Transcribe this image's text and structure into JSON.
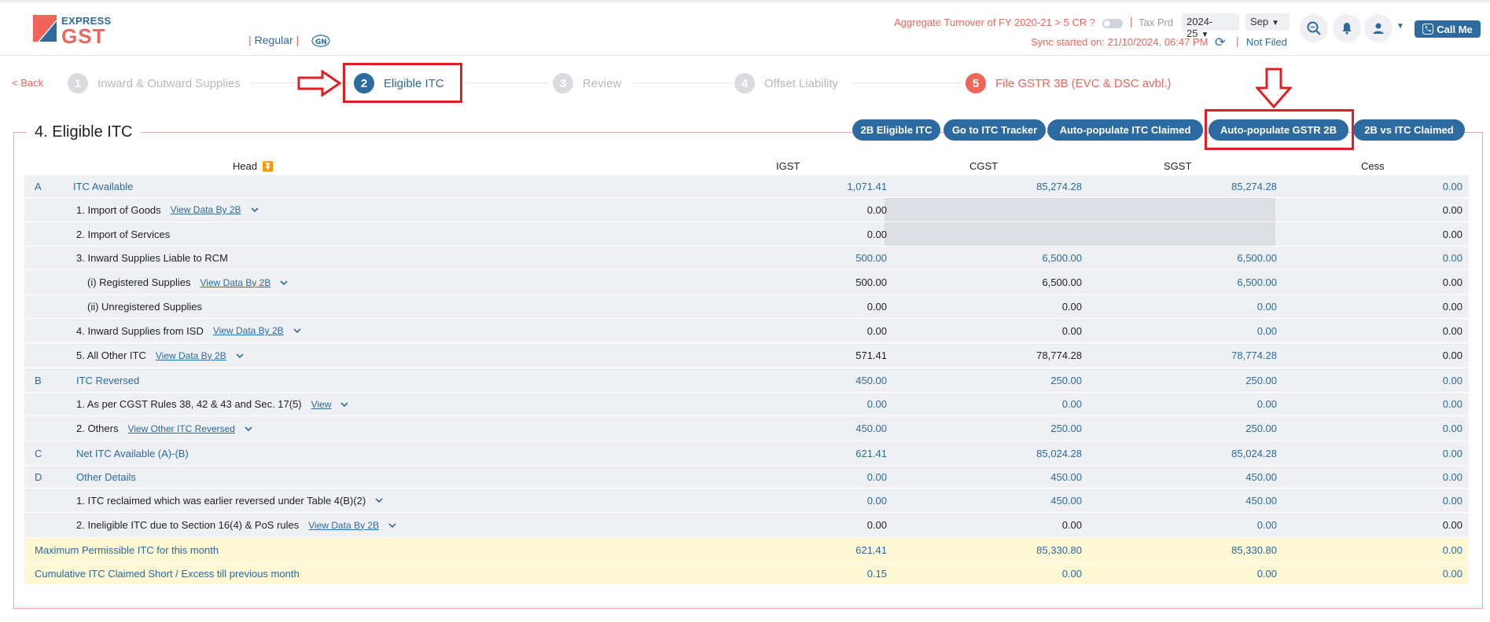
{
  "header": {
    "logo_top": "EXPRESS",
    "logo_main": "GST",
    "plan": "Regular",
    "aggregate_text": "Aggregate Turnover of FY 2020-21 > 5 CR ?",
    "tax_period_label": "Tax Prd",
    "fy_value": "2024-25",
    "month_value": "Sep",
    "sync_text": "Sync started on: 21/10/2024, 06:47 PM",
    "filing_status": "Not Filed",
    "call_me": "Call Me"
  },
  "steps": {
    "back": "< Back",
    "items": [
      {
        "num": "1",
        "label": "Inward & Outward Supplies"
      },
      {
        "num": "2",
        "label": "Eligible ITC"
      },
      {
        "num": "3",
        "label": "Review"
      },
      {
        "num": "4",
        "label": "Offset Liability"
      },
      {
        "num": "5",
        "label": "File GSTR 3B (EVC & DSC avbl.)"
      }
    ]
  },
  "section": {
    "title": "4. Eligible ITC",
    "buttons": [
      "2B Eligible ITC",
      "Go to ITC Tracker",
      "Auto-populate ITC Claimed",
      "Auto-populate GSTR 2B",
      "2B vs ITC Claimed"
    ]
  },
  "table": {
    "columns": {
      "head": "Head",
      "igst": "IGST",
      "cgst": "CGST",
      "sgst": "SGST",
      "cess": "Cess"
    },
    "rows": [
      {
        "letter": "A",
        "head": "ITC Available",
        "igst": "1,071.41",
        "cgst": "85,274.28",
        "sgst": "85,274.28",
        "cess": "0.00"
      },
      {
        "head": "1.  Import of Goods",
        "link": "View Data By 2B",
        "igst": "0.00",
        "cess": "0.00"
      },
      {
        "head": "2.  Import of Services",
        "igst": "0.00",
        "cess": "0.00"
      },
      {
        "head": "3.  Inward Supplies Liable to RCM",
        "igst": "500.00",
        "cgst": "6,500.00",
        "sgst": "6,500.00",
        "cess": "0.00"
      },
      {
        "head": "(i) Registered Supplies",
        "link": "View Data By 2B",
        "igst": "500.00",
        "cgst": "6,500.00",
        "sgst": "6,500.00",
        "cess": "0.00"
      },
      {
        "head": "(ii) Unregistered Supplies",
        "igst": "0.00",
        "cgst": "0.00",
        "sgst": "0.00",
        "cess": "0.00"
      },
      {
        "head": "4.  Inward Supplies from ISD",
        "link": "View Data By 2B",
        "igst": "0.00",
        "cgst": "0.00",
        "sgst": "0.00",
        "cess": "0.00"
      },
      {
        "head": "5.  All Other ITC",
        "link": "View Data By 2B",
        "igst": "571.41",
        "cgst": "78,774.28",
        "sgst": "78,774.28",
        "cess": "0.00"
      },
      {
        "letter": "B",
        "head": "ITC Reversed",
        "igst": "450.00",
        "cgst": "250.00",
        "sgst": "250.00",
        "cess": "0.00"
      },
      {
        "head": "1.  As per CGST Rules 38, 42 & 43 and Sec. 17(5)",
        "link": "View",
        "igst": "0.00",
        "cgst": "0.00",
        "sgst": "0.00",
        "cess": "0.00"
      },
      {
        "head": "2.  Others",
        "link": "View Other ITC Reversed",
        "igst": "450.00",
        "cgst": "250.00",
        "sgst": "250.00",
        "cess": "0.00"
      },
      {
        "letter": "C",
        "head": "Net ITC Available (A)-(B)",
        "igst": "621.41",
        "cgst": "85,024.28",
        "sgst": "85,024.28",
        "cess": "0.00"
      },
      {
        "letter": "D",
        "head": "Other Details",
        "igst": "0.00",
        "cgst": "450.00",
        "sgst": "450.00",
        "cess": "0.00"
      },
      {
        "head": "1. ITC reclaimed which was earlier reversed under Table 4(B)(2)",
        "igst": "0.00",
        "cgst": "450.00",
        "sgst": "450.00",
        "cess": "0.00"
      },
      {
        "head": "2. Ineligible ITC due to Section 16(4) & PoS rules",
        "link": "View Data By 2B",
        "igst": "0.00",
        "cgst": "0.00",
        "sgst": "0.00",
        "cess": "0.00"
      },
      {
        "head": "Maximum Permissible ITC for this month",
        "igst": "621.41",
        "cgst": "85,330.80",
        "sgst": "85,330.80",
        "cess": "0.00"
      },
      {
        "head": "Cumulative ITC Claimed Short / Excess till previous month",
        "igst": "0.15",
        "cgst": "0.00",
        "sgst": "0.00",
        "cess": "0.00"
      }
    ]
  },
  "colors": {
    "brand_blue": "#2c6aa0",
    "brand_coral": "#f0645a",
    "highlight_red": "#e01e26"
  }
}
